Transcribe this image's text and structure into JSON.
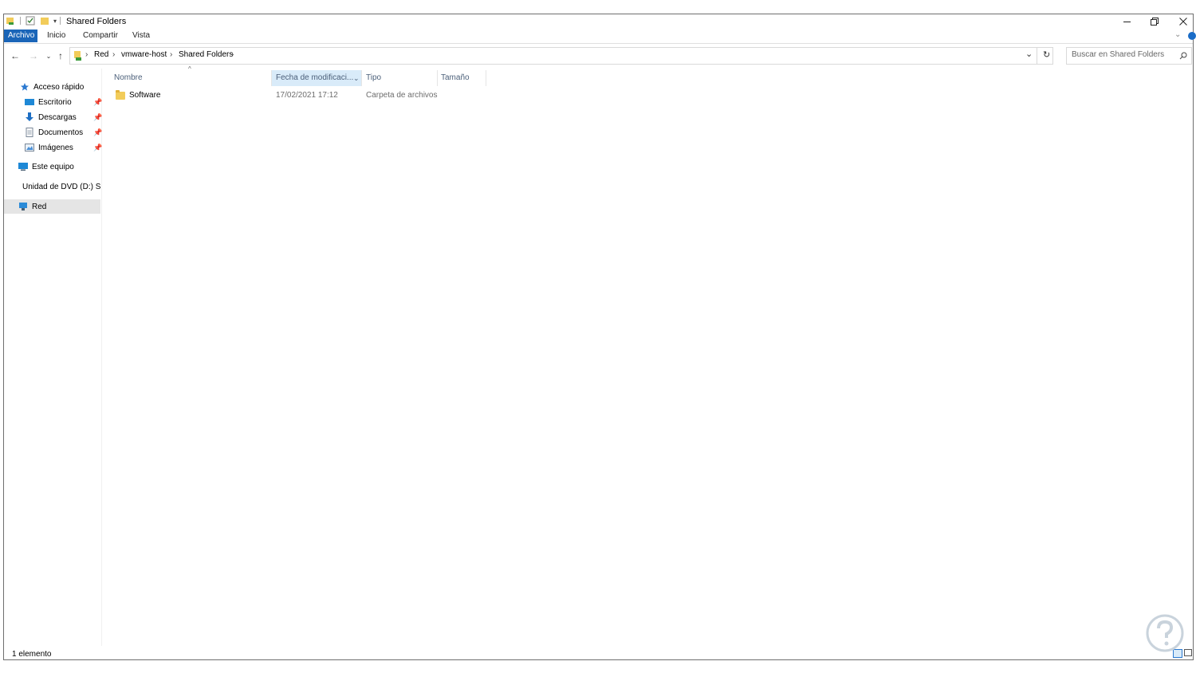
{
  "window": {
    "title": "Shared Folders"
  },
  "ribbon": {
    "tabs": [
      "Archivo",
      "Inicio",
      "Compartir",
      "Vista"
    ]
  },
  "address": {
    "crumbs": [
      "Red",
      "vmware-host",
      "Shared Folders"
    ]
  },
  "search": {
    "placeholder": "Buscar en Shared Folders"
  },
  "navpane": {
    "quick_access": "Acceso rápido",
    "items": [
      "Escritorio",
      "Descargas",
      "Documentos",
      "Imágenes"
    ],
    "this_pc": "Este equipo",
    "dvd": "Unidad de DVD (D:) S",
    "network": "Red"
  },
  "columns": {
    "name": "Nombre",
    "date": "Fecha de modificaci...",
    "type": "Tipo",
    "size": "Tamaño"
  },
  "files": [
    {
      "name": "Software",
      "date": "17/02/2021 17:12",
      "type": "Carpeta de archivos",
      "size": ""
    }
  ],
  "status": {
    "count": "1 elemento"
  },
  "colors": {
    "accent": "#1a65b8",
    "selected": "#e5e5e5",
    "header_sorted": "#d9ebf9"
  }
}
